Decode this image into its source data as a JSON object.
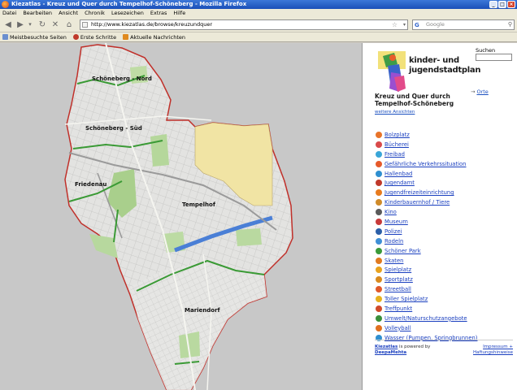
{
  "window": {
    "title": "Kiezatlas - Kreuz und Quer durch Tempelhof-Schöneberg - Mozilla Firefox",
    "buttons": {
      "minimize": "_",
      "maximize": "□",
      "close": "×"
    }
  },
  "menu": [
    "Datei",
    "Bearbeiten",
    "Ansicht",
    "Chronik",
    "Lesezeichen",
    "Extras",
    "Hilfe"
  ],
  "toolbar": {
    "back": "◀",
    "forward": "▶",
    "dropdown": "▾",
    "reload": "↻",
    "stop": "✕",
    "home": "⌂",
    "url": "http://www.kiezatlas.de/browse/kreuzundquer",
    "search_engine": "G",
    "search_placeholder": "Google",
    "search_icon": "⚲",
    "bookmark_star": "☆"
  },
  "bookmarks": [
    {
      "label": "Meistbesuchte Seiten",
      "icon": "bookmark-folder-icon",
      "color": "#6b8fcf"
    },
    {
      "label": "Erste Schritte",
      "icon": "firefox-icon",
      "color": "#c0392b"
    },
    {
      "label": "Aktuelle Nachrichten",
      "icon": "rss-icon",
      "color": "#e08a1e"
    }
  ],
  "map": {
    "districts": [
      {
        "label": "Schöneberg - Nord"
      },
      {
        "label": "Schöneberg - Süd"
      },
      {
        "label": "Friedenau"
      },
      {
        "label": "Tempelhof"
      },
      {
        "label": "Mariendorf"
      }
    ]
  },
  "sidebar": {
    "logo_line1": "kinder- und",
    "logo_line2": "jugendstadtplan",
    "search_label": "Suchen",
    "orte_arrow": "→",
    "orte_link": "Orte",
    "title": "Kreuz und Quer durch Tempelhof-Schöneberg",
    "more_views": "weitere Ansichten",
    "categories": [
      {
        "label": "Bolzplatz",
        "color": "#e8742a"
      },
      {
        "label": "Bücherei",
        "color": "#d94a4a"
      },
      {
        "label": "Freibad",
        "color": "#3aa6d8"
      },
      {
        "label": "Gefährliche Verkehrssituation",
        "color": "#e65a2a"
      },
      {
        "label": "Hallenbad",
        "color": "#2f8fd0"
      },
      {
        "label": "Jugendamt",
        "color": "#c0392b"
      },
      {
        "label": "Jugendfreizeiteinrichtung",
        "color": "#e87b1e"
      },
      {
        "label": "Kinderbauernhof / Tiere",
        "color": "#d08b2a"
      },
      {
        "label": "Kino",
        "color": "#5a5a5a"
      },
      {
        "label": "Museum",
        "color": "#c83a3a"
      },
      {
        "label": "Polizei",
        "color": "#2c5fa8"
      },
      {
        "label": "Rodeln",
        "color": "#3f8fd6"
      },
      {
        "label": "Schöner Park",
        "color": "#3a9a3a"
      },
      {
        "label": "Skaten",
        "color": "#e07a20"
      },
      {
        "label": "Spielplatz",
        "color": "#e8a21e"
      },
      {
        "label": "Sportplatz",
        "color": "#d88a1e"
      },
      {
        "label": "Streetball",
        "color": "#e0592a"
      },
      {
        "label": "Toller Spielplatz",
        "color": "#e6b01e"
      },
      {
        "label": "Treffpunkt",
        "color": "#d04a2a"
      },
      {
        "label": "Umwelt/Naturschutzangebote",
        "color": "#3a8f3a"
      },
      {
        "label": "Volleyball",
        "color": "#e07020"
      },
      {
        "label": "Wasser (Pumpen, Springbrunnen)",
        "color": "#2f8fd0"
      }
    ],
    "footer_brand": "Kiezatlas",
    "footer_powered": " is powered by ",
    "footer_company": "DeepaMehta",
    "footer_impressum": "Impressum +",
    "footer_haftung": "Haftungshinweise"
  }
}
